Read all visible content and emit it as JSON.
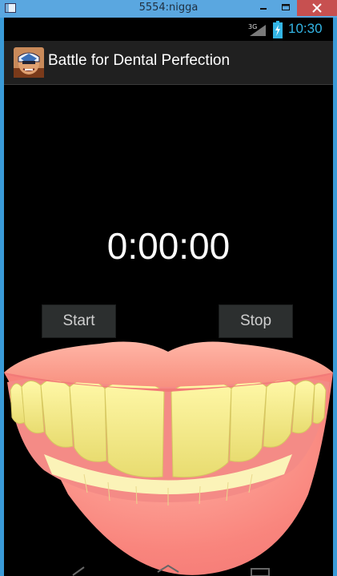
{
  "window": {
    "title": "5554:nigga"
  },
  "status_bar": {
    "network": "3G",
    "time": "10:30"
  },
  "action_bar": {
    "title": "Battle for Dental Perfection",
    "icon": "superhero-dentist-icon"
  },
  "timer": {
    "display": "0:00:00"
  },
  "buttons": {
    "start_label": "Start",
    "stop_label": "Stop"
  },
  "colors": {
    "status_time": "#33b5e5",
    "actionbar": "#202020",
    "background": "#000000"
  }
}
